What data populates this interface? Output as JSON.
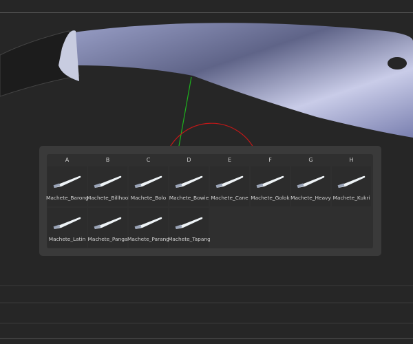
{
  "columns": [
    "A",
    "B",
    "C",
    "D",
    "E",
    "F",
    "G",
    "H"
  ],
  "items": [
    {
      "label": "Machete_Barong"
    },
    {
      "label": "Machete_Billhook"
    },
    {
      "label": "Machete_Bolo"
    },
    {
      "label": "Machete_Bowie"
    },
    {
      "label": "Machete_Cane"
    },
    {
      "label": "Machete_Golok"
    },
    {
      "label": "Machete_Heavy"
    },
    {
      "label": "Machete_Kukri"
    },
    {
      "label": "Machete_Latin"
    },
    {
      "label": "Machete_Panga"
    },
    {
      "label": "Machete_Parang"
    },
    {
      "label": "Machete_Tapang"
    }
  ]
}
